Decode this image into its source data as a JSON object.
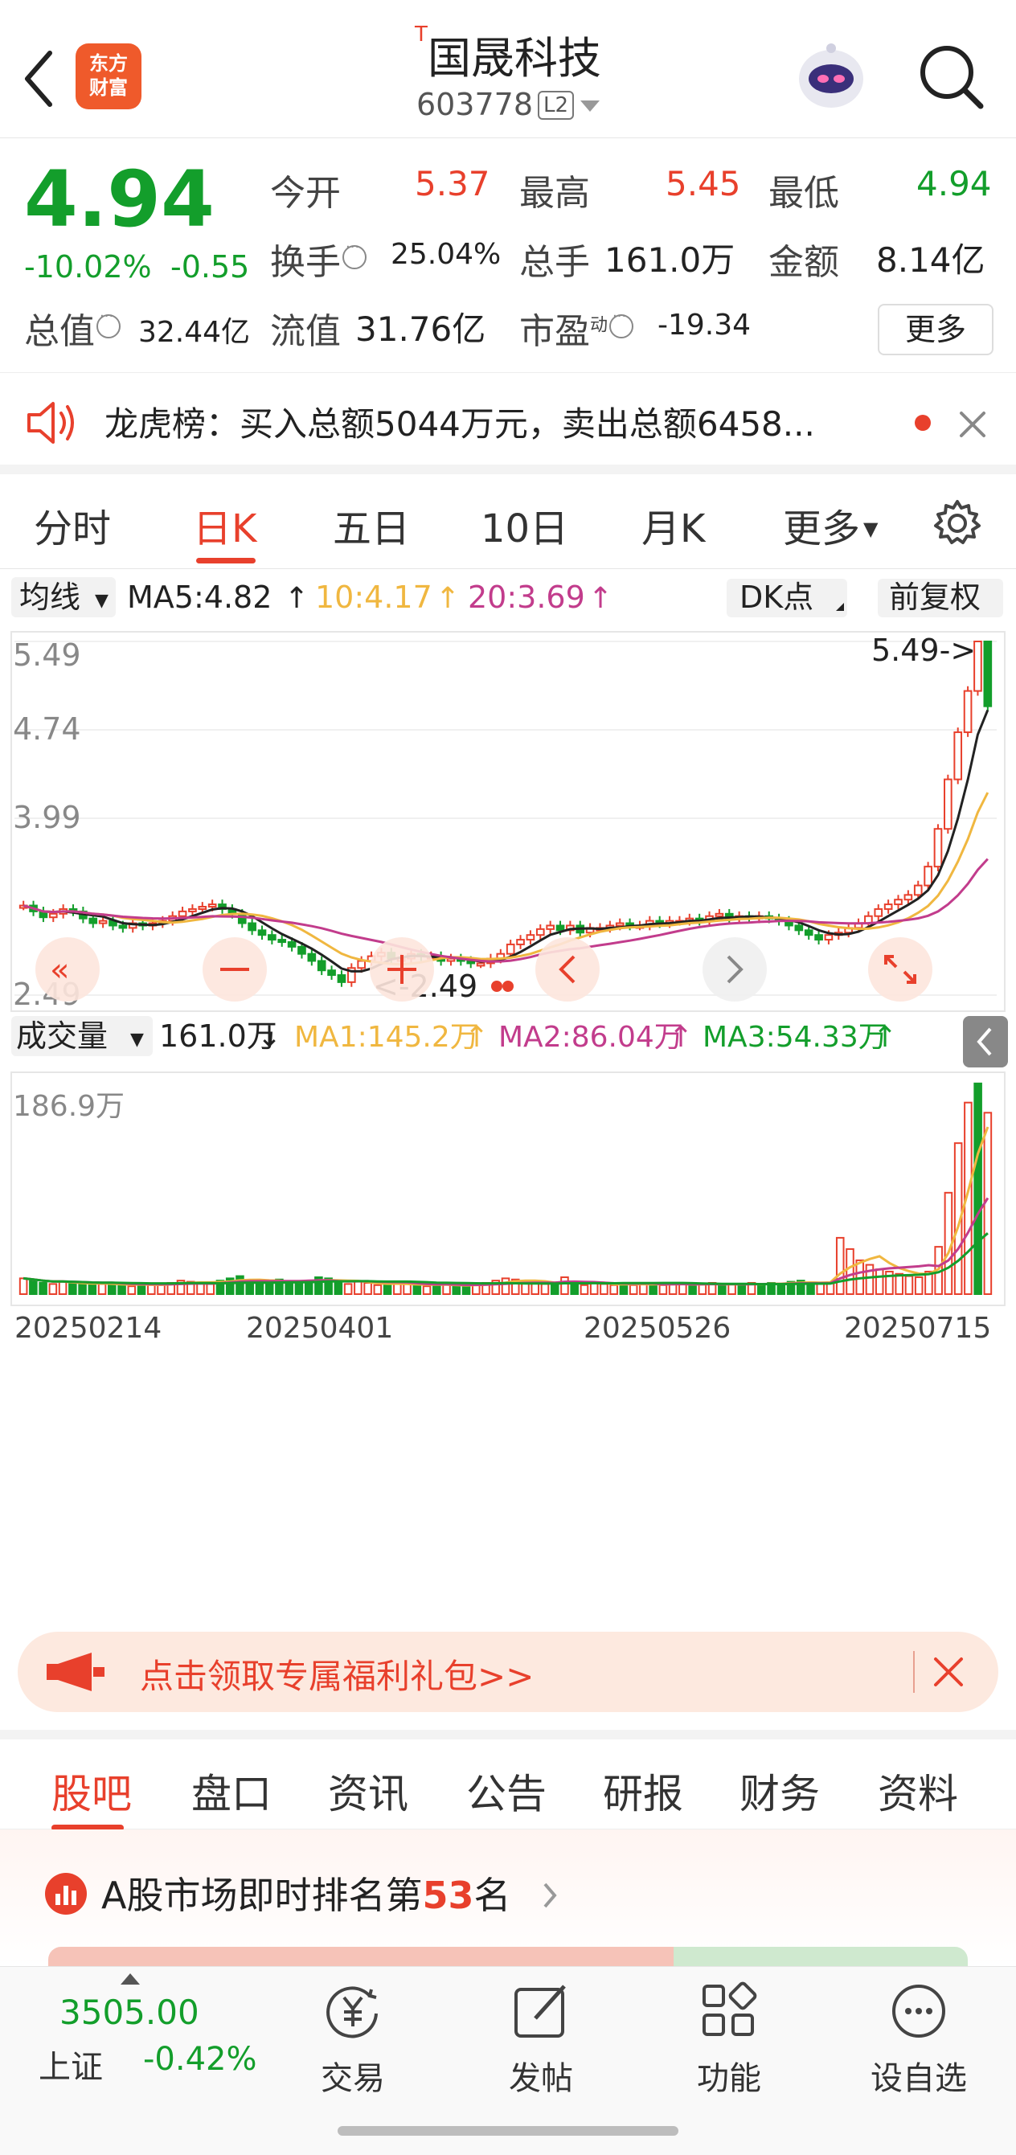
{
  "header": {
    "back_icon": "chevron-left-icon",
    "logo_line1": "东方",
    "logo_line2": "财富",
    "title_mark": "T",
    "title": "国晟科技",
    "code": "603778",
    "level_tag": "L2",
    "robot_icon": "robot-avatar-icon",
    "search_icon": "search-icon"
  },
  "quote": {
    "price": "4.94",
    "change_pct": "-10.02%",
    "change_amt": "-0.55",
    "open_label": "今开",
    "open": "5.37",
    "high_label": "最高",
    "high": "5.45",
    "low_label": "最低",
    "low": "4.94",
    "turnover_label": "换手",
    "turnover": "25.04%",
    "volume_label": "总手",
    "volume": "161.0万",
    "amount_label": "金额",
    "amount": "8.14亿",
    "mktcap_label": "总值",
    "mktcap": "32.44亿",
    "float_label": "流值",
    "float_cap": "31.76亿",
    "pe_label": "市盈",
    "pe_sup": "动",
    "pe": "-19.34",
    "more_label": "更多"
  },
  "notice": {
    "icon": "speaker-icon",
    "text": "龙虎榜：买入总额5044万元，卖出总额6458...",
    "close_icon": "close-icon"
  },
  "tabs": {
    "items": [
      "分时",
      "日K",
      "五日",
      "10日",
      "月K",
      "更多"
    ],
    "active": "日K",
    "settings_icon": "gear-icon"
  },
  "chart_data": [
    {
      "type": "candlestick",
      "indicator_label": "均线",
      "ma5_label": "MA5:4.82",
      "ma10_label": "10:4.17",
      "ma20_label": "20:3.69",
      "dk_label": "DK点",
      "adjust_label": "前复权",
      "y_ticks": [
        "5.49",
        "4.74",
        "3.99",
        "2.49"
      ],
      "max_marker": "5.49->",
      "min_marker": "<-2.49",
      "ylim": [
        2.49,
        5.49
      ],
      "closes": [
        3.25,
        3.2,
        3.15,
        3.18,
        3.22,
        3.2,
        3.14,
        3.1,
        3.12,
        3.08,
        3.06,
        3.1,
        3.08,
        3.1,
        3.12,
        3.16,
        3.2,
        3.22,
        3.24,
        3.26,
        3.22,
        3.18,
        3.1,
        3.04,
        3.0,
        2.96,
        2.94,
        2.9,
        2.84,
        2.78,
        2.7,
        2.66,
        2.6,
        2.72,
        2.78,
        2.82,
        2.85,
        2.8,
        2.8,
        2.84,
        2.82,
        2.82,
        2.78,
        2.8,
        2.78,
        2.76,
        2.76,
        2.8,
        2.84,
        2.92,
        2.96,
        3.0,
        3.05,
        3.08,
        3.04,
        3.08,
        3.02,
        3.06,
        3.06,
        3.08,
        3.1,
        3.08,
        3.08,
        3.12,
        3.1,
        3.12,
        3.12,
        3.14,
        3.12,
        3.16,
        3.18,
        3.14,
        3.16,
        3.14,
        3.16,
        3.14,
        3.12,
        3.08,
        3.04,
        3.0,
        2.96,
        3.0,
        3.02,
        3.06,
        3.1,
        3.16,
        3.22,
        3.26,
        3.3,
        3.34,
        3.42,
        3.58,
        3.9,
        4.32,
        4.72,
        5.07,
        5.49,
        4.94
      ]
    },
    {
      "type": "bar",
      "indicator_label": "成交量",
      "volume_label": "161.0万",
      "ma1_label": "MA1:145.2万",
      "ma2_label": "MA2:86.04万",
      "ma3_label": "MA3:54.33万",
      "y_max_label": "186.9万",
      "ylim": [
        0,
        186.9
      ],
      "x_ticks": [
        "20250214",
        "20250401",
        "20250526",
        "20250715"
      ],
      "volumes": [
        14,
        12,
        10,
        9,
        11,
        10,
        9,
        8,
        9,
        10,
        8,
        7,
        9,
        8,
        9,
        10,
        12,
        11,
        10,
        9,
        12,
        14,
        16,
        12,
        10,
        9,
        13,
        11,
        10,
        12,
        15,
        14,
        10,
        9,
        11,
        10,
        8,
        8,
        9,
        10,
        8,
        7,
        8,
        9,
        8,
        7,
        8,
        10,
        12,
        14,
        13,
        11,
        10,
        9,
        8,
        15,
        9,
        8,
        10,
        9,
        8,
        9,
        8,
        10,
        9,
        8,
        9,
        9,
        8,
        9,
        10,
        8,
        9,
        8,
        10,
        9,
        10,
        9,
        11,
        12,
        10,
        9,
        10,
        50,
        40,
        30,
        26,
        22,
        20,
        18,
        16,
        15,
        20,
        42,
        90,
        134,
        170,
        187,
        161
      ]
    }
  ],
  "promo": {
    "icon": "megaphone-icon",
    "text": "点击领取专属福利礼包>>",
    "close_icon": "close-icon"
  },
  "section_tabs": {
    "items": [
      "股吧",
      "盘口",
      "资讯",
      "公告",
      "研报",
      "财务",
      "资料"
    ],
    "active": "股吧"
  },
  "rank": {
    "prefix": "A股市场即时排名第",
    "num": "53",
    "suffix": "名"
  },
  "bottom": {
    "index_value": "3505.00",
    "index_name": "上证",
    "index_change": "-0.42%",
    "nav": [
      {
        "label": "交易",
        "icon": "yen-trade-icon"
      },
      {
        "label": "发帖",
        "icon": "edit-post-icon"
      },
      {
        "label": "功能",
        "icon": "apps-grid-icon"
      },
      {
        "label": "设自选",
        "icon": "more-dots-icon"
      }
    ]
  },
  "colors": {
    "up": "#e8402c",
    "down": "#139e2b",
    "ma5": "#222222",
    "ma10": "#f0b740",
    "ma20": "#c23c8c",
    "accent": "#e8402c"
  }
}
